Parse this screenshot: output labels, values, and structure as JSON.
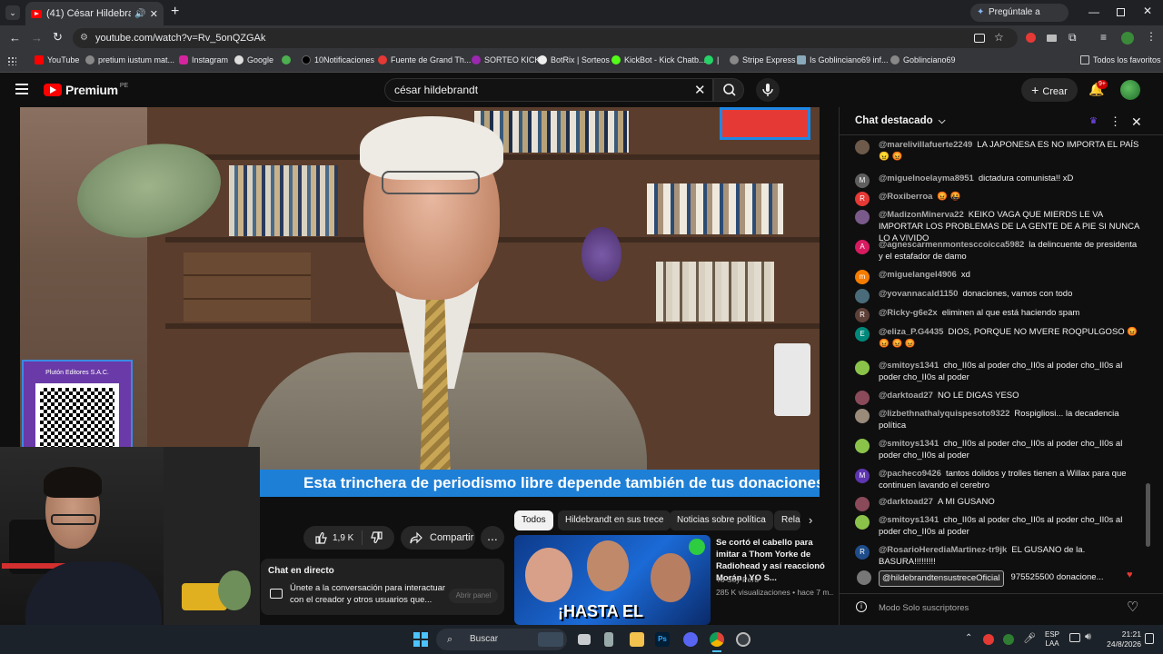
{
  "browser": {
    "tab_title": "(41) César Hildebrandt en ",
    "new_tab_glyph": "+",
    "gemini_label": "Pregúntale a Gemini",
    "url": "youtube.com/watch?v=Rv_5onQZGAk",
    "bookmarks": [
      "YouTube",
      "pretium iustum mat...",
      "Instagram",
      "Google",
      "10Notificaciones",
      "Fuente de Grand Th...",
      "SORTEO KICK",
      "BotRix | Sorteos",
      "KickBot - Kick Chatb...",
      "|",
      "Stripe Express",
      "Is Goblinciano69 inf...",
      "Goblinciano69"
    ],
    "all_favorites": "Todos los favoritos"
  },
  "youtube": {
    "logo_text": "Premium",
    "logo_region": "PE",
    "search_value": "césar hildebrandt",
    "create_label": "Crear",
    "notif_badge": "9+"
  },
  "video": {
    "ticker_text": "Esta trinchera de periodismo libre depende también de tus donaciones",
    "sponsor_label": "Plutón Editores S.A.C.",
    "likes": "1,9 K",
    "share_label": "Compartir",
    "more_glyph": "..."
  },
  "livechat_box": {
    "title": "Chat en directo",
    "description": "Únete a la conversación para interactuar con el creador y otros usuarios que...",
    "open_label": "Abrir panel"
  },
  "chips": [
    "Todos",
    "Hildebrandt en sus trece",
    "Noticias sobre política",
    "Rela"
  ],
  "recommended": {
    "title": "Se cortó el cabello para imitar a Thom Yorke de Radiohead y así reaccionó Morán | YO S...",
    "channel": "Yo Soy Perú",
    "meta": "285 K visualizaciones • hace 7 m...",
    "thumb_text": "¡HASTA EL"
  },
  "chat": {
    "header": "Chat destacado",
    "messages": [
      {
        "author": "@marelivillafuerte2249",
        "text": "LA JAPONESA ES NO IMPORTA EL PAÍS 😠 😡",
        "initial": "",
        "color": "#6d5a4a"
      },
      {
        "author": "@miguelnoelayma8951",
        "text": "dictadura comunista!! xD",
        "initial": "M",
        "color": "#5f5f5f"
      },
      {
        "author": "@Roxiberroa",
        "text": "😡 🤬",
        "initial": "R",
        "color": "#e53935"
      },
      {
        "author": "@MadizonMinerva22",
        "text": "KEIKO VAGA QUE MIERDS LE VA IMPORTAR LOS PROBLEMAS DE LA GENTE DE A PIE SI NUNCA LO A VIVIDO",
        "initial": "",
        "color": "#7a5a8a"
      },
      {
        "author": "@agnescarmenmontesccoicca5982",
        "text": "la delincuente de presidenta y el estafador de damo",
        "initial": "A",
        "color": "#d81b60"
      },
      {
        "author": "@miguelangel4906",
        "text": "xd",
        "initial": "m",
        "color": "#f57c00"
      },
      {
        "author": "@yovannacald1150",
        "text": "donaciones, vamos con todo",
        "initial": "",
        "color": "#4a6b7a"
      },
      {
        "author": "@Ricky-g6e2x",
        "text": "eliminen al que está haciendo spam",
        "initial": "R",
        "color": "#5d4037"
      },
      {
        "author": "@eliza_P.G4435",
        "text": "DIOS, PORQUE NO MVERE ROQPULGOSO 😡 😡 😡 😡",
        "initial": "E",
        "color": "#00897b"
      },
      {
        "author": "@smitoys1341",
        "text": "cho_II0s al poder cho_II0s al poder cho_II0s al poder cho_II0s al poder",
        "initial": "",
        "color": "#8bc34a"
      },
      {
        "author": "@darktoad27",
        "text": "NO LE DIGAS YESO",
        "initial": "",
        "color": "#8a4a5a"
      },
      {
        "author": "@lizbethnathalyquispesoto9322",
        "text": "Rospigliosi... la decadencia política",
        "initial": "",
        "color": "#9a8a7a"
      },
      {
        "author": "@smitoys1341",
        "text": "cho_II0s al poder cho_II0s al poder cho_II0s al poder cho_II0s al poder",
        "initial": "",
        "color": "#8bc34a"
      },
      {
        "author": "@pacheco9426",
        "text": "tantos dolidos y trolles tienen a Willax para que continuen lavando el cerebro",
        "initial": "M",
        "color": "#5e35b1"
      },
      {
        "author": "@darktoad27",
        "text": "A MI GUSANO",
        "initial": "",
        "color": "#8a4a5a"
      },
      {
        "author": "@smitoys1341",
        "text": "cho_II0s al poder cho_II0s al poder cho_II0s al poder cho_II0s al poder",
        "initial": "",
        "color": "#8bc34a"
      },
      {
        "author": "@RosarioHerediaMartinez-tr9jk",
        "text": "EL GUSANO de la. BASURA!!!!!!!!!",
        "initial": "R",
        "color": "#1e4d8a"
      }
    ],
    "pinned_author": "@hildebrandtensustreceOficial",
    "pinned_text": "975525500 donacione...",
    "mode": "Modo Solo suscriptores"
  },
  "taskbar": {
    "search_label": "Buscar",
    "lang": "ESP",
    "lang2": "LAA",
    "time": "21:21",
    "date": "24/8/2026"
  }
}
